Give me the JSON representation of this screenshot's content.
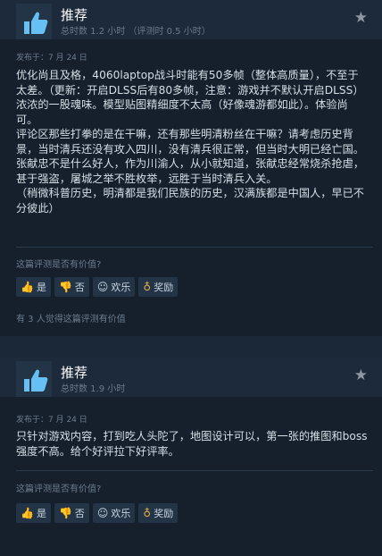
{
  "reviews": [
    {
      "recommendation": "推荐",
      "hours": "总时数 1.2 小时  （评测时 0.5 小时）",
      "posted": "发布于：7 月 24 日",
      "paragraphs": [
        "优化尚且及格，4060laptop战斗时能有50多帧（整体高质量），不至于太差。（更新：开启DLSS后有80多帧，注意：游戏并不默认开启DLSS）",
        "浓浓的一股魂味。模型贴图精细度不太高（好像魂游都如此）。体验尚可。",
        "评论区那些打拳的是在干嘛，还有那些明清粉丝在干嘛？请考虑历史背景，当时清兵还没有攻入四川，没有清兵很正常，但当时大明已经亡国。张献忠不是什么好人，作为川渝人，从小就知道，张献忠经常烧杀抢虐，甚于强盗，屠城之举不胜枚举，远胜于当时清兵入关。",
        "（稍微科普历史，明清都是我们民族的历史，汉满族都是中国人，早已不分彼此）"
      ],
      "helpful_question": "这篇评测是否有价值?",
      "helpful_count": "有 3 人觉得这篇评测有价值"
    },
    {
      "recommendation": "推荐",
      "hours": "总时数 1.9 小时",
      "posted": "发布于：7 月 24 日",
      "paragraphs": [
        "只针对游戏内容，打到吃人头陀了，地图设计可以，第一张的推图和boss强度不高。给个好评拉下好评率。"
      ],
      "helpful_question": "这篇评测是否有价值?"
    }
  ],
  "buttons": {
    "yes": "是",
    "no": "否",
    "funny": "欢乐",
    "award": "奖励"
  },
  "icons": {
    "thumbs_up": "thumbs-up-icon",
    "star": "star-icon",
    "yes": "thumbs-up-icon",
    "no": "thumbs-down-icon",
    "funny": "smiley-icon",
    "award": "award-icon"
  },
  "colors": {
    "background": "#1b2838",
    "card": "#16202d",
    "thumb_icon": "#66c0f4",
    "award": "#e3b341"
  }
}
